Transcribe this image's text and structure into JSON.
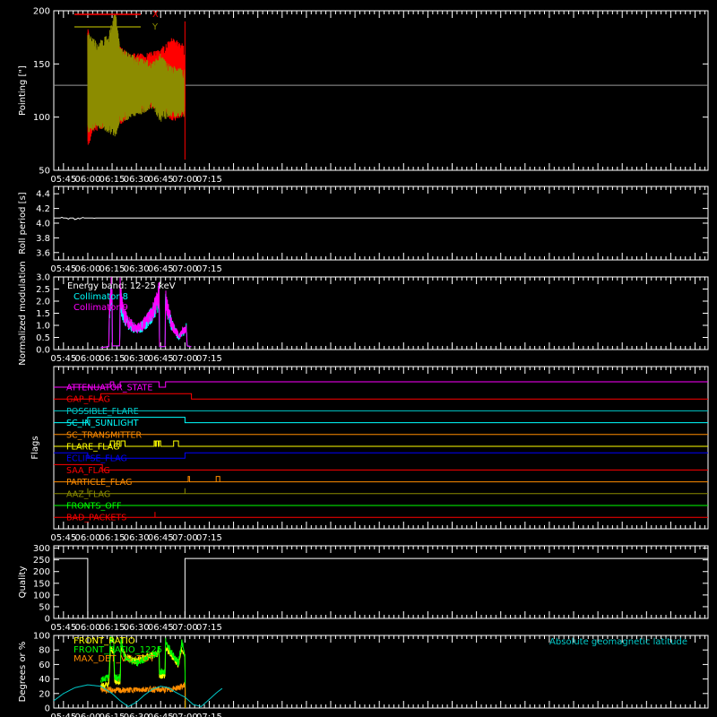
{
  "time_axis": {
    "range_minutes": [
      339,
      743
    ],
    "ticks": [
      {
        "label": "05:45",
        "t": 345
      },
      {
        "label": "06:00",
        "t": 360
      },
      {
        "label": "06:15",
        "t": 375
      },
      {
        "label": "06:30",
        "t": 390
      },
      {
        "label": "06:45",
        "t": 405
      },
      {
        "label": "07:00",
        "t": 420
      },
      {
        "label": "07:15",
        "t": 435
      }
    ]
  },
  "colors": {
    "background": "#000000",
    "axes": "#ffffff",
    "red": "#ff0000",
    "olive": "#8c8c00",
    "cyan": "#00ffff",
    "magenta": "#ff00ff",
    "orange": "#ff8c00",
    "yellow": "#ffff00",
    "green": "#00ff00",
    "blue": "#0000ff",
    "teal": "#00c8c8",
    "grey": "#999999"
  },
  "chart_data": [
    {
      "type": "line",
      "panel": "pointing",
      "ylabel": "Pointing [\"]",
      "ylim": [
        50,
        200
      ],
      "yticks": [
        50,
        100,
        150,
        200
      ],
      "legend_position": "top-left",
      "series": [
        {
          "name": "X",
          "color": "#ff0000",
          "center": 130,
          "envelope": [
            [
              360,
              70,
              185
            ],
            [
              363,
              85,
              160
            ],
            [
              370,
              90,
              165
            ],
            [
              375,
              95,
              175
            ],
            [
              378,
              88,
              170
            ],
            [
              385,
              100,
              160
            ],
            [
              395,
              105,
              160
            ],
            [
              405,
              110,
              165
            ],
            [
              412,
              95,
              175
            ],
            [
              418,
              100,
              170
            ],
            [
              420,
              100,
              165
            ]
          ]
        },
        {
          "name": "Y",
          "color": "#8c8c00",
          "center": 130,
          "envelope": [
            [
              360,
              85,
              180
            ],
            [
              366,
              90,
              170
            ],
            [
              373,
              85,
              180
            ],
            [
              377,
              80,
              200
            ],
            [
              380,
              95,
              165
            ],
            [
              390,
              100,
              158
            ],
            [
              400,
              108,
              152
            ],
            [
              405,
              95,
              160
            ],
            [
              410,
              100,
              150
            ],
            [
              420,
              100,
              145
            ]
          ]
        }
      ],
      "reference_line": {
        "y": 130,
        "color": "#999999"
      }
    },
    {
      "type": "line",
      "panel": "roll",
      "ylabel": "Roll period [s]",
      "ylim": [
        3.5,
        4.5
      ],
      "yticks": [
        3.6,
        3.8,
        4.0,
        4.2,
        4.4
      ],
      "series": [
        {
          "name": "",
          "color": "#ffffff",
          "x": [
            339,
            743
          ],
          "y": [
            4.07,
            4.07
          ]
        }
      ]
    },
    {
      "type": "line",
      "panel": "modulation",
      "ylabel": "Normalized modulation",
      "ylim": [
        0,
        3.0
      ],
      "yticks": [
        0.0,
        0.5,
        1.0,
        1.5,
        2.0,
        2.5,
        3.0
      ],
      "legend_position": "top-left",
      "legend_title": "Energy band: 12-25 keV",
      "series": [
        {
          "name": "Collimator 8",
          "color": "#00ffff",
          "x": [
            368,
            373,
            373.3,
            374.5,
            375,
            375.2,
            379.7,
            380,
            381,
            383,
            386,
            390,
            393,
            397,
            400,
            403,
            404,
            404.3,
            407.7,
            408,
            409,
            412,
            416,
            420,
            421,
            421.3,
            424
          ],
          "y": [
            0.08,
            0.12,
            1.4,
            2.5,
            1.9,
            0.15,
            0.15,
            2.3,
            1.7,
            1.3,
            1.0,
            0.8,
            0.9,
            1.2,
            1.5,
            1.9,
            2.3,
            0.12,
            0.12,
            2.0,
            1.6,
            1.0,
            0.5,
            0.8,
            0.9,
            0.15,
            0.12
          ]
        },
        {
          "name": "Collimator 9",
          "color": "#ff00ff",
          "x": [
            368,
            373,
            373.3,
            374.5,
            375,
            375.2,
            379.7,
            380,
            381,
            383,
            386,
            390,
            393,
            397,
            400,
            403,
            404,
            404.3,
            407.7,
            408,
            409,
            412,
            416,
            420,
            421,
            421.3,
            424
          ],
          "y": [
            0.08,
            0.12,
            1.5,
            2.6,
            2.0,
            0.15,
            0.15,
            2.4,
            1.8,
            1.35,
            1.05,
            0.85,
            0.95,
            1.25,
            1.6,
            2.0,
            2.4,
            0.12,
            0.12,
            2.1,
            1.7,
            1.05,
            0.55,
            0.85,
            0.95,
            0.15,
            0.12
          ]
        }
      ]
    },
    {
      "type": "line",
      "panel": "flags",
      "ylabel": "Flags",
      "flags": [
        {
          "name": "ATTENUATOR_STATE",
          "color": "#ff00ff",
          "steps": [
            [
              339,
              0
            ],
            [
              374,
              1
            ],
            [
              376,
              0
            ],
            [
              380,
              1
            ],
            [
              404,
              0
            ],
            [
              408,
              1
            ],
            [
              743,
              1
            ]
          ]
        },
        {
          "name": "GAP_FLAG",
          "color": "#ff0000",
          "steps": [
            [
              339,
              0
            ],
            [
              368,
              1
            ],
            [
              424,
              0
            ],
            [
              743,
              0
            ]
          ]
        },
        {
          "name": "POSSIBLE_FLARE",
          "color": "#00c8c8",
          "steps": [
            [
              339,
              0
            ],
            [
              743,
              0
            ]
          ]
        },
        {
          "name": "SC_IN_SUNLIGHT",
          "color": "#00ffff",
          "steps": [
            [
              339,
              0
            ],
            [
              360,
              1
            ],
            [
              420,
              0
            ],
            [
              743,
              0
            ]
          ]
        },
        {
          "name": "SC_TRANSMITTER",
          "color": "#ff8c00",
          "steps": [
            [
              339,
              0
            ],
            [
              743,
              0
            ]
          ]
        },
        {
          "name": "FLARE_FLAG",
          "color": "#ffff00",
          "steps": [
            [
              339,
              0
            ],
            [
              374,
              1
            ],
            [
              376.5,
              0
            ],
            [
              378,
              1
            ],
            [
              379.5,
              0
            ],
            [
              380.5,
              1
            ],
            [
              383,
              0
            ],
            [
              401,
              1
            ],
            [
              401.7,
              0
            ],
            [
              402.3,
              1
            ],
            [
              403.5,
              0
            ],
            [
              404,
              1
            ],
            [
              405,
              0
            ],
            [
              413,
              1
            ],
            [
              416,
              0
            ],
            [
              743,
              0
            ]
          ]
        },
        {
          "name": "ECLIPSE_FLAG",
          "color": "#0000ff",
          "steps": [
            [
              339,
              1
            ],
            [
              360,
              0
            ],
            [
              420,
              1
            ],
            [
              743,
              1
            ]
          ]
        },
        {
          "name": "SAA_FLAG",
          "color": "#ff0000",
          "steps": [
            [
              339,
              1
            ],
            [
              369,
              0
            ],
            [
              743,
              0
            ]
          ]
        },
        {
          "name": "PARTICLE_FLAG",
          "color": "#ff8c00",
          "steps": [
            [
              339,
              0
            ],
            [
              422,
              1
            ],
            [
              422.8,
              0
            ],
            [
              743,
              0
            ]
          ]
        },
        {
          "name": "AAZ_FLAG",
          "color": "#8c8c00",
          "steps": [
            [
              339,
              0
            ],
            [
              743,
              0
            ]
          ]
        },
        {
          "name": "FRONTS_OFF",
          "color": "#00ff00",
          "steps": [
            [
              339,
              0
            ],
            [
              743,
              0
            ]
          ]
        },
        {
          "name": "BAD_PACKETS",
          "color": "#ff0000",
          "steps": [
            [
              339,
              0
            ],
            [
              743,
              0
            ]
          ]
        }
      ]
    },
    {
      "type": "line",
      "panel": "quality",
      "ylabel": "Quality",
      "ylim": [
        0,
        310
      ],
      "yticks": [
        0,
        50,
        100,
        150,
        200,
        250,
        300
      ],
      "series": [
        {
          "name": "",
          "color": "#ffffff",
          "x": [
            339,
            360,
            360,
            420,
            420,
            743
          ],
          "y": [
            256,
            256,
            0,
            0,
            256,
            256
          ]
        }
      ]
    },
    {
      "type": "line",
      "panel": "ratios",
      "ylabel": "Degrees or %",
      "ylim": [
        0,
        100
      ],
      "yticks": [
        0,
        20,
        40,
        60,
        80,
        100
      ],
      "legend_position": "top-left",
      "series": [
        {
          "name": "FRONT_RATIO",
          "color": "#ffff00",
          "x": [
            368,
            373,
            374,
            376,
            376.5,
            380,
            380.5,
            383,
            386,
            390,
            395,
            400,
            403,
            404,
            404.3,
            407.7,
            408,
            412,
            416,
            418,
            420,
            420.2
          ],
          "y": [
            30,
            32,
            80,
            80,
            37,
            37,
            85,
            72,
            68,
            65,
            70,
            72,
            75,
            80,
            45,
            45,
            82,
            72,
            60,
            82,
            70,
            0
          ]
        },
        {
          "name": "FRONT_RATIO_1225",
          "color": "#00ff00",
          "x": [
            368,
            373,
            374,
            376,
            376.5,
            380,
            380.5,
            383,
            386,
            390,
            395,
            400,
            403,
            404,
            404.3,
            407.7,
            408,
            412,
            416,
            418,
            420,
            420.2
          ],
          "y": [
            40,
            42,
            95,
            95,
            42,
            42,
            92,
            70,
            65,
            62,
            68,
            72,
            75,
            88,
            50,
            50,
            92,
            75,
            62,
            92,
            70,
            0
          ]
        },
        {
          "name": "MAX_DET_VS_TOT",
          "color": "#ff8c00",
          "x": [
            368,
            380,
            395,
            410,
            419,
            420,
            420.2
          ],
          "y": [
            25,
            24,
            26,
            25,
            30,
            35,
            0
          ]
        },
        {
          "name": "Absolute geomagnetic latitude",
          "color": "#00c8c8",
          "x": [
            339,
            345,
            352,
            360,
            368,
            375,
            380,
            385,
            390,
            395,
            400,
            405,
            410,
            414,
            420,
            425,
            430,
            435,
            440,
            443
          ],
          "y": [
            10,
            20,
            28,
            32,
            30,
            20,
            10,
            2,
            8,
            18,
            26,
            30,
            28,
            22,
            15,
            5,
            2,
            12,
            22,
            27
          ]
        }
      ]
    }
  ]
}
